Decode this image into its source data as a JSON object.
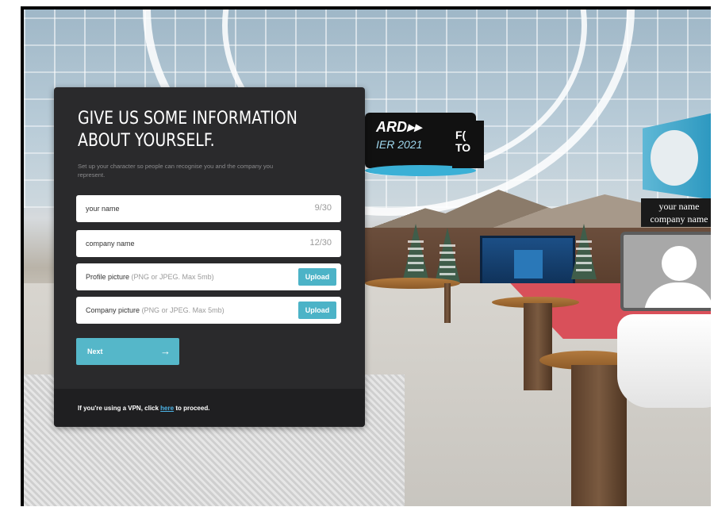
{
  "scene": {
    "sign_text_1": "ARD▸▸",
    "sign_text_2": "IER 2021",
    "sign_text_3": "F( TO",
    "avatar_name": "your name",
    "avatar_company": "company name",
    "colors": {
      "accent": "#55b7c9",
      "dialog_bg": "#2a2a2c",
      "link": "#4cb3e6",
      "carpet": "#d9505a"
    }
  },
  "dialog": {
    "title_line1": "GIVE US SOME INFORMATION",
    "title_line2": "ABOUT YOURSELF.",
    "subtitle": "Set up your character so people can recognise you and the company you represent.",
    "fields": [
      {
        "label": "your name",
        "counter": "9/30"
      },
      {
        "label": "company name",
        "counter": "12/30"
      }
    ],
    "uploads": [
      {
        "label": "Profile picture",
        "hint": "(PNG or JPEG. Max 5mb)",
        "button": "Upload"
      },
      {
        "label": "Company picture",
        "hint": "(PNG or JPEG. Max 5mb)",
        "button": "Upload"
      }
    ],
    "next_label": "Next",
    "next_icon": "arrow-right-icon",
    "next_arrow": "→",
    "footer_prefix": "If you're using a VPN, click",
    "footer_link": "here",
    "footer_suffix": "to proceed."
  }
}
